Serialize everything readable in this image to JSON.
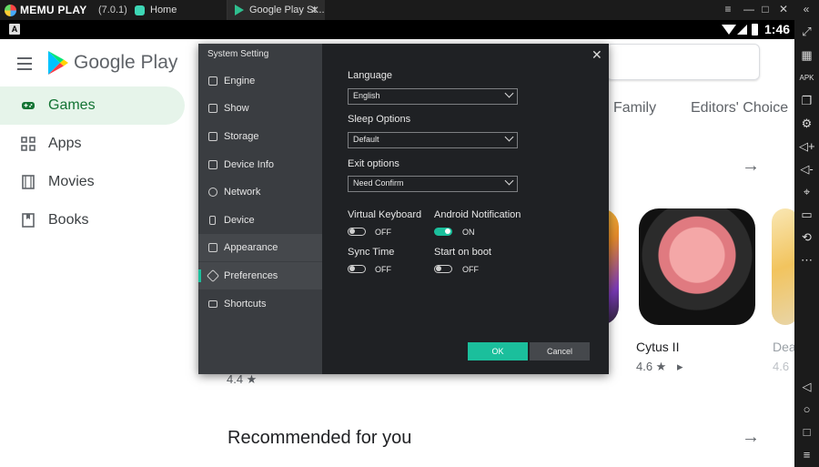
{
  "emulator": {
    "brand": "MEMU PLAY",
    "version": "(7.0.1)",
    "tabs": [
      {
        "label": "Home"
      },
      {
        "label": "Google Play St..."
      }
    ],
    "window_controls": [
      "≡",
      "—",
      "□",
      "✕",
      "«"
    ]
  },
  "statusbar": {
    "badge": "A",
    "time": "1:46"
  },
  "play": {
    "brand": "Google Play",
    "sidebar": [
      {
        "label": "Games",
        "icon": "gamepad-icon",
        "active": true
      },
      {
        "label": "Apps",
        "icon": "apps-grid-icon",
        "active": false
      },
      {
        "label": "Movies",
        "icon": "film-icon",
        "active": false
      },
      {
        "label": "Books",
        "icon": "bookmark-icon",
        "active": false
      }
    ],
    "categories": [
      "Family",
      "Editors' Choice"
    ],
    "games": [
      {
        "name": "Cytus II",
        "rating": "4.6 ★",
        "badge": "▸"
      },
      {
        "name": "Dea",
        "rating": "4.6"
      }
    ],
    "left_rating": "4.4 ★",
    "recommended_title": "Recommended for you"
  },
  "dialog": {
    "title": "System Setting",
    "nav": [
      {
        "label": "Engine",
        "icon": "cpu-icon"
      },
      {
        "label": "Show",
        "icon": "monitor-icon"
      },
      {
        "label": "Storage",
        "icon": "storage-icon"
      },
      {
        "label": "Device Info",
        "icon": "device-info-icon"
      },
      {
        "label": "Network",
        "icon": "globe-icon"
      },
      {
        "label": "Device",
        "icon": "phone-icon"
      },
      {
        "label": "Appearance",
        "icon": "appearance-icon"
      },
      {
        "label": "Preferences",
        "icon": "wrench-icon"
      },
      {
        "label": "Shortcuts",
        "icon": "keyboard-icon"
      }
    ],
    "active_nav": "Preferences",
    "language": {
      "label": "Language",
      "value": "English"
    },
    "sleep": {
      "label": "Sleep Options",
      "value": "Default"
    },
    "exit": {
      "label": "Exit options",
      "value": "Need Confirm"
    },
    "toggles": {
      "virtual_keyboard": {
        "label": "Virtual Keyboard",
        "state": "OFF"
      },
      "android_notification": {
        "label": "Android Notification",
        "state": "ON"
      },
      "sync_time": {
        "label": "Sync Time",
        "state": "OFF"
      },
      "start_on_boot": {
        "label": "Start on boot",
        "state": "OFF"
      }
    },
    "ok_label": "OK",
    "cancel_label": "Cancel",
    "accent": "#1bbf9c"
  }
}
